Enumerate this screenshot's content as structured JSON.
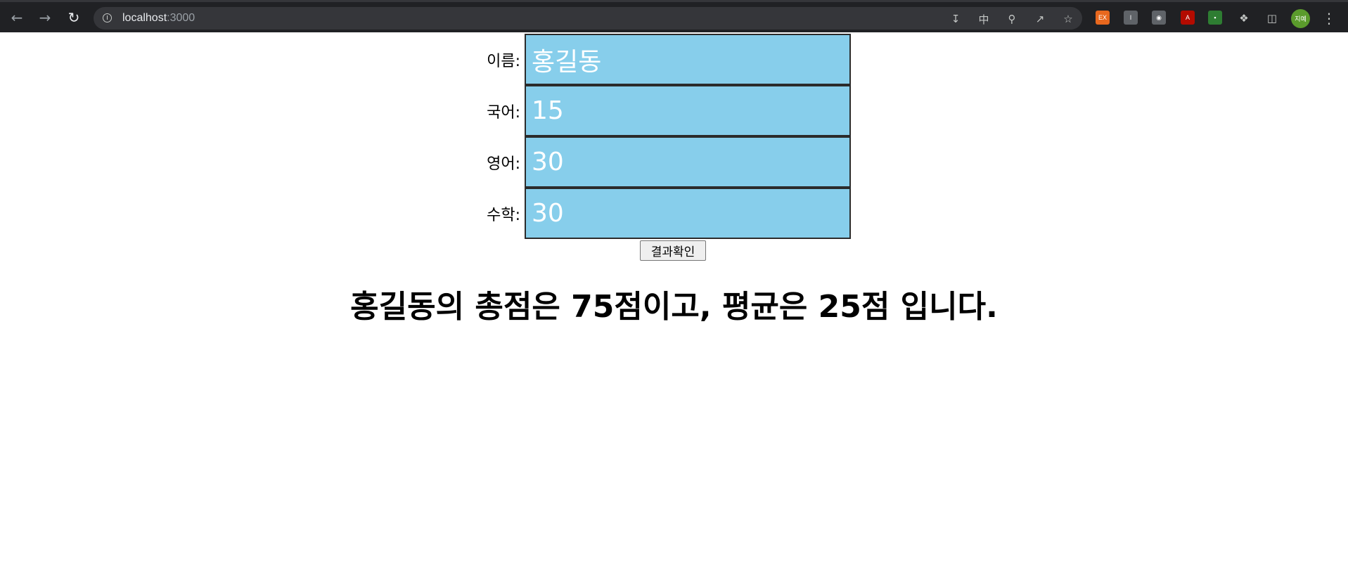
{
  "browser": {
    "url_host": "localhost",
    "url_port": ":3000",
    "avatar_text": "지예",
    "extensions": [
      {
        "name": "ex-extension-icon",
        "label": "EX",
        "color": "#e8681e"
      },
      {
        "name": "i-extension-icon",
        "label": "I",
        "color": "#5f6368"
      },
      {
        "name": "camera-extension-icon",
        "label": "◉",
        "color": "#5f6368"
      },
      {
        "name": "pdf-extension-icon",
        "label": "A",
        "color": "#b30b00"
      },
      {
        "name": "green-extension-icon",
        "label": "▪",
        "color": "#2e7d32"
      }
    ]
  },
  "form": {
    "fields": [
      {
        "label": "이름:",
        "value": "홍길동"
      },
      {
        "label": "국어:",
        "value": "15"
      },
      {
        "label": "영어:",
        "value": "30"
      },
      {
        "label": "수학:",
        "value": "30"
      }
    ],
    "submit_label": "결과확인"
  },
  "result": {
    "text": "홍길동의 총점은 75점이고, 평균은 25점 입니다."
  },
  "colors": {
    "input_background": "#87ceeb",
    "browser_chrome": "#202124"
  }
}
